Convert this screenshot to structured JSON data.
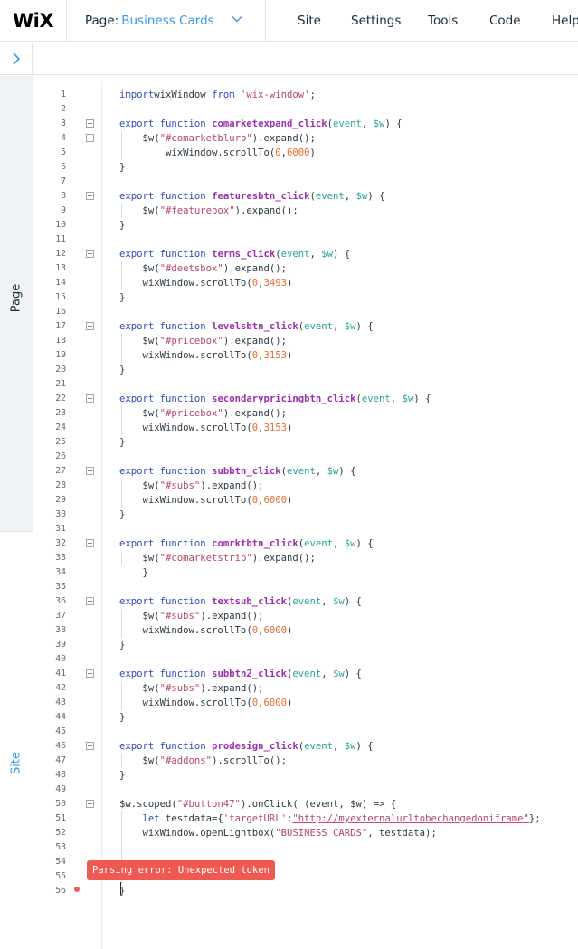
{
  "header": {
    "logo": "WiX",
    "page_label": "Page:",
    "page_value": "Business Cards",
    "menu": [
      "Site",
      "Settings",
      "Tools",
      "Code",
      "Help"
    ]
  },
  "sidebar": {
    "tabs": [
      "Page",
      "Site"
    ]
  },
  "editor": {
    "lines": [
      {
        "n": "1",
        "fold": false,
        "tokens": [
          [
            "kw",
            "import"
          ],
          [
            "",
            "wixWindow "
          ],
          [
            "kw",
            "from"
          ],
          [
            "str",
            " 'wix-window'"
          ],
          [
            "",
            ";"
          ]
        ]
      },
      {
        "n": "2",
        "fold": false,
        "tokens": []
      },
      {
        "n": "3",
        "fold": true,
        "tokens": [
          [
            "kw",
            "export function "
          ],
          [
            "fn",
            "comarketexpand_click"
          ],
          [
            "",
            "("
          ],
          [
            "pm",
            "event"
          ],
          [
            "",
            ", "
          ],
          [
            "pm",
            "$w"
          ],
          [
            "",
            ") {"
          ]
        ]
      },
      {
        "n": "4",
        "fold": true,
        "tokens": [
          [
            "",
            "    $w("
          ],
          [
            "str",
            "\"#comarketblurb\""
          ],
          [
            "",
            ").expand();"
          ]
        ]
      },
      {
        "n": "5",
        "fold": false,
        "tokens": [
          [
            "",
            "        wixWindow.scrollTo("
          ],
          [
            "num",
            "0"
          ],
          [
            "",
            ","
          ],
          [
            "num",
            "6000"
          ],
          [
            "",
            ")"
          ]
        ]
      },
      {
        "n": "6",
        "fold": false,
        "tokens": [
          [
            "",
            "}"
          ]
        ]
      },
      {
        "n": "7",
        "fold": false,
        "tokens": []
      },
      {
        "n": "8",
        "fold": true,
        "tokens": [
          [
            "kw",
            "export function "
          ],
          [
            "fn",
            "featuresbtn_click"
          ],
          [
            "",
            "("
          ],
          [
            "pm",
            "event"
          ],
          [
            "",
            ", "
          ],
          [
            "pm",
            "$w"
          ],
          [
            "",
            ") {"
          ]
        ]
      },
      {
        "n": "9",
        "fold": false,
        "tokens": [
          [
            "",
            "    $w("
          ],
          [
            "str",
            "\"#featurebox\""
          ],
          [
            "",
            ").expand();"
          ]
        ]
      },
      {
        "n": "10",
        "fold": false,
        "tokens": [
          [
            "",
            "}"
          ]
        ]
      },
      {
        "n": "11",
        "fold": false,
        "tokens": []
      },
      {
        "n": "12",
        "fold": true,
        "tokens": [
          [
            "kw",
            "export function "
          ],
          [
            "fn",
            "terms_click"
          ],
          [
            "",
            "("
          ],
          [
            "pm",
            "event"
          ],
          [
            "",
            ", "
          ],
          [
            "pm",
            "$w"
          ],
          [
            "",
            ") {"
          ]
        ]
      },
      {
        "n": "13",
        "fold": false,
        "tokens": [
          [
            "",
            "    $w("
          ],
          [
            "str",
            "\"#deetsbox\""
          ],
          [
            "",
            ").expand();"
          ]
        ]
      },
      {
        "n": "14",
        "fold": false,
        "tokens": [
          [
            "",
            "    wixWindow.scrollTo("
          ],
          [
            "num",
            "0"
          ],
          [
            "",
            ","
          ],
          [
            "num",
            "3493"
          ],
          [
            "",
            ")"
          ]
        ]
      },
      {
        "n": "15",
        "fold": false,
        "tokens": [
          [
            "",
            "}"
          ]
        ]
      },
      {
        "n": "16",
        "fold": false,
        "tokens": []
      },
      {
        "n": "17",
        "fold": true,
        "tokens": [
          [
            "kw",
            "export function "
          ],
          [
            "fn",
            "levelsbtn_click"
          ],
          [
            "",
            "("
          ],
          [
            "pm",
            "event"
          ],
          [
            "",
            ", "
          ],
          [
            "pm",
            "$w"
          ],
          [
            "",
            ") {"
          ]
        ]
      },
      {
        "n": "18",
        "fold": false,
        "tokens": [
          [
            "",
            "    $w("
          ],
          [
            "str",
            "\"#pricebox\""
          ],
          [
            "",
            ").expand();"
          ]
        ]
      },
      {
        "n": "19",
        "fold": false,
        "tokens": [
          [
            "",
            "    wixWindow.scrollTo("
          ],
          [
            "num",
            "0"
          ],
          [
            "",
            ","
          ],
          [
            "num",
            "3153"
          ],
          [
            "",
            ")"
          ]
        ]
      },
      {
        "n": "20",
        "fold": false,
        "tokens": [
          [
            "",
            "}"
          ]
        ]
      },
      {
        "n": "21",
        "fold": false,
        "tokens": []
      },
      {
        "n": "22",
        "fold": true,
        "tokens": [
          [
            "kw",
            "export function "
          ],
          [
            "fn",
            "secondarypricingbtn_click"
          ],
          [
            "",
            "("
          ],
          [
            "pm",
            "event"
          ],
          [
            "",
            ", "
          ],
          [
            "pm",
            "$w"
          ],
          [
            "",
            ") {"
          ]
        ]
      },
      {
        "n": "23",
        "fold": false,
        "tokens": [
          [
            "",
            "    $w("
          ],
          [
            "str",
            "\"#pricebox\""
          ],
          [
            "",
            ").expand();"
          ]
        ]
      },
      {
        "n": "24",
        "fold": false,
        "tokens": [
          [
            "",
            "    wixWindow.scrollTo("
          ],
          [
            "num",
            "0"
          ],
          [
            "",
            ","
          ],
          [
            "num",
            "3153"
          ],
          [
            "",
            ")"
          ]
        ]
      },
      {
        "n": "25",
        "fold": false,
        "tokens": [
          [
            "",
            "}"
          ]
        ]
      },
      {
        "n": "26",
        "fold": false,
        "tokens": []
      },
      {
        "n": "27",
        "fold": true,
        "tokens": [
          [
            "kw",
            "export function "
          ],
          [
            "fn",
            "subbtn_click"
          ],
          [
            "",
            "("
          ],
          [
            "pm",
            "event"
          ],
          [
            "",
            ", "
          ],
          [
            "pm",
            "$w"
          ],
          [
            "",
            ") {"
          ]
        ]
      },
      {
        "n": "28",
        "fold": false,
        "tokens": [
          [
            "",
            "    $w("
          ],
          [
            "str",
            "\"#subs\""
          ],
          [
            "",
            ").expand();"
          ]
        ]
      },
      {
        "n": "29",
        "fold": false,
        "tokens": [
          [
            "",
            "    wixWindow.scrollTo("
          ],
          [
            "num",
            "0"
          ],
          [
            "",
            ","
          ],
          [
            "num",
            "6000"
          ],
          [
            "",
            ")"
          ]
        ]
      },
      {
        "n": "30",
        "fold": false,
        "tokens": [
          [
            "",
            "}"
          ]
        ]
      },
      {
        "n": "31",
        "fold": false,
        "tokens": []
      },
      {
        "n": "32",
        "fold": true,
        "tokens": [
          [
            "kw",
            "export function "
          ],
          [
            "fn",
            "comrktbtn_click"
          ],
          [
            "",
            "("
          ],
          [
            "pm",
            "event"
          ],
          [
            "",
            ", "
          ],
          [
            "pm",
            "$w"
          ],
          [
            "",
            ") {"
          ]
        ]
      },
      {
        "n": "33",
        "fold": false,
        "tokens": [
          [
            "",
            "    $w("
          ],
          [
            "str",
            "\"#comarketstrip\""
          ],
          [
            "",
            ").expand();"
          ]
        ]
      },
      {
        "n": "34",
        "fold": false,
        "tokens": [
          [
            "",
            "    }"
          ]
        ]
      },
      {
        "n": "35",
        "fold": false,
        "tokens": []
      },
      {
        "n": "36",
        "fold": true,
        "tokens": [
          [
            "kw",
            "export function "
          ],
          [
            "fn",
            "textsub_click"
          ],
          [
            "",
            "("
          ],
          [
            "pm",
            "event"
          ],
          [
            "",
            ", "
          ],
          [
            "pm",
            "$w"
          ],
          [
            "",
            ") {"
          ]
        ]
      },
      {
        "n": "37",
        "fold": false,
        "tokens": [
          [
            "",
            "    $w("
          ],
          [
            "str",
            "\"#subs\""
          ],
          [
            "",
            ").expand();"
          ]
        ]
      },
      {
        "n": "38",
        "fold": false,
        "tokens": [
          [
            "",
            "    wixWindow.scrollTo("
          ],
          [
            "num",
            "0"
          ],
          [
            "",
            ","
          ],
          [
            "num",
            "6000"
          ],
          [
            "",
            ")"
          ]
        ]
      },
      {
        "n": "39",
        "fold": false,
        "tokens": [
          [
            "",
            "}"
          ]
        ]
      },
      {
        "n": "40",
        "fold": false,
        "tokens": []
      },
      {
        "n": "41",
        "fold": true,
        "tokens": [
          [
            "kw",
            "export function "
          ],
          [
            "fn",
            "subbtn2_click"
          ],
          [
            "",
            "("
          ],
          [
            "pm",
            "event"
          ],
          [
            "",
            ", "
          ],
          [
            "pm",
            "$w"
          ],
          [
            "",
            ") {"
          ]
        ]
      },
      {
        "n": "42",
        "fold": false,
        "tokens": [
          [
            "",
            "    $w("
          ],
          [
            "str",
            "\"#subs\""
          ],
          [
            "",
            ").expand();"
          ]
        ]
      },
      {
        "n": "43",
        "fold": false,
        "tokens": [
          [
            "",
            "    wixWindow.scrollTo("
          ],
          [
            "num",
            "0"
          ],
          [
            "",
            ","
          ],
          [
            "num",
            "6000"
          ],
          [
            "",
            ")"
          ]
        ]
      },
      {
        "n": "44",
        "fold": false,
        "tokens": [
          [
            "",
            "}"
          ]
        ]
      },
      {
        "n": "45",
        "fold": false,
        "tokens": []
      },
      {
        "n": "46",
        "fold": true,
        "tokens": [
          [
            "kw",
            "export function "
          ],
          [
            "fn",
            "prodesign_click"
          ],
          [
            "",
            "("
          ],
          [
            "pm",
            "event"
          ],
          [
            "",
            ", "
          ],
          [
            "pm",
            "$w"
          ],
          [
            "",
            ") {"
          ]
        ]
      },
      {
        "n": "47",
        "fold": false,
        "tokens": [
          [
            "",
            "    $w("
          ],
          [
            "str",
            "\"#addons\""
          ],
          [
            "",
            ").scrollTo();"
          ]
        ]
      },
      {
        "n": "48",
        "fold": false,
        "tokens": [
          [
            "",
            "}"
          ]
        ]
      },
      {
        "n": "49",
        "fold": false,
        "tokens": []
      },
      {
        "n": "50",
        "fold": true,
        "tokens": [
          [
            "",
            "$w.scoped("
          ],
          [
            "str",
            "\"#button47\""
          ],
          [
            "",
            ").onClick( (event, $w) => {"
          ]
        ]
      },
      {
        "n": "51",
        "fold": false,
        "tokens": [
          [
            "",
            "    "
          ],
          [
            "kw",
            "let"
          ],
          [
            "",
            " testdata={"
          ],
          [
            "str",
            "'targetURL'"
          ],
          [
            "",
            ":"
          ],
          [
            "url",
            "\"http://myexternalurltobechangedoniframe\""
          ],
          [
            "",
            "};"
          ]
        ]
      },
      {
        "n": "52",
        "fold": false,
        "tokens": [
          [
            "",
            "    wixWindow.openLightbox("
          ],
          [
            "str",
            "\"BUSINESS CARDS\""
          ],
          [
            "",
            ", testdata);"
          ]
        ]
      },
      {
        "n": "53",
        "fold": false,
        "tokens": []
      },
      {
        "n": "54",
        "fold": false,
        "tokens": []
      },
      {
        "n": "55",
        "fold": false,
        "tokens": []
      },
      {
        "n": "56",
        "fold": false,
        "tokens": [
          [
            "",
            "}"
          ]
        ]
      }
    ],
    "error_message": "Parsing error: Unexpected token",
    "colors": {
      "keyword": "#2e4bb6",
      "function": "#9b2fae",
      "param": "#2aa198",
      "string": "#b5476a",
      "number": "#e86d2f",
      "error": "#ee5951",
      "accent": "#3899ec"
    }
  }
}
